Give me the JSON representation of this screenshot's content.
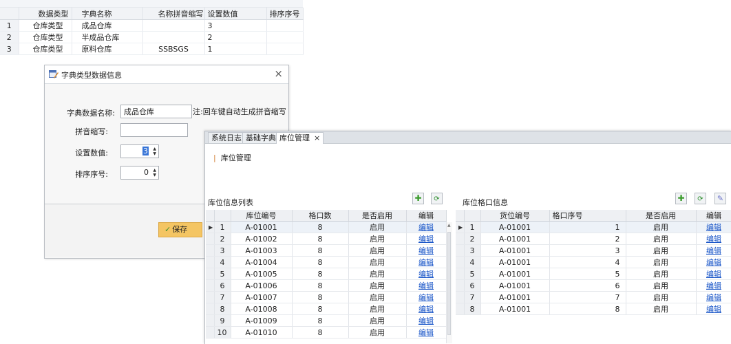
{
  "bg_table": {
    "columns": [
      "数据类型",
      "字典名称",
      "名称拼音缩写",
      "设置数值",
      "排序序号"
    ],
    "rows": [
      {
        "no": "1",
        "type": "仓库类型",
        "name": "成品仓库",
        "abbr": "",
        "value": "3",
        "order": ""
      },
      {
        "no": "2",
        "type": "仓库类型",
        "name": "半成品仓库",
        "abbr": "",
        "value": "2",
        "order": ""
      },
      {
        "no": "3",
        "type": "仓库类型",
        "name": "原料仓库",
        "abbr": "SSBSGS",
        "value": "1",
        "order": ""
      }
    ]
  },
  "dict_dialog": {
    "title": "字典类型数据信息",
    "close": "×",
    "labels": {
      "name": "字典数据名称:",
      "pinyin": "拼音缩写:",
      "value": "设置数值:",
      "order": "排序序号:"
    },
    "fields": {
      "name": "成品仓库",
      "pinyin": "",
      "value": "3",
      "order": "0"
    },
    "note": "注:回车键自动生成拼音缩写",
    "save_label": "保存"
  },
  "location_window": {
    "tabs": [
      "系统日志",
      "基础字典",
      "库位管理"
    ],
    "active_tab": "库位管理",
    "tab_close": "×",
    "breadcrumb": "库位管理",
    "left_grid": {
      "title": "库位信息列表",
      "columns": [
        "库位编号",
        "格口数",
        "是否启用",
        "编辑"
      ],
      "rows": [
        {
          "no": "1",
          "code": "A-01001",
          "slots": "8",
          "enabled": "启用",
          "edit": "编辑"
        },
        {
          "no": "2",
          "code": "A-01002",
          "slots": "8",
          "enabled": "启用",
          "edit": "编辑"
        },
        {
          "no": "3",
          "code": "A-01003",
          "slots": "8",
          "enabled": "启用",
          "edit": "编辑"
        },
        {
          "no": "4",
          "code": "A-01004",
          "slots": "8",
          "enabled": "启用",
          "edit": "编辑"
        },
        {
          "no": "5",
          "code": "A-01005",
          "slots": "8",
          "enabled": "启用",
          "edit": "编辑"
        },
        {
          "no": "6",
          "code": "A-01006",
          "slots": "8",
          "enabled": "启用",
          "edit": "编辑"
        },
        {
          "no": "7",
          "code": "A-01007",
          "slots": "8",
          "enabled": "启用",
          "edit": "编辑"
        },
        {
          "no": "8",
          "code": "A-01008",
          "slots": "8",
          "enabled": "启用",
          "edit": "编辑"
        },
        {
          "no": "9",
          "code": "A-01009",
          "slots": "8",
          "enabled": "启用",
          "edit": "编辑"
        },
        {
          "no": "10",
          "code": "A-01010",
          "slots": "8",
          "enabled": "启用",
          "edit": "编辑"
        }
      ]
    },
    "right_grid": {
      "title": "库位格口信息",
      "columns": [
        "货位编号",
        "格口序号",
        "是否启用",
        "编辑"
      ],
      "rows": [
        {
          "no": "1",
          "code": "A-01001",
          "seq": "1",
          "enabled": "启用",
          "edit": "编辑"
        },
        {
          "no": "2",
          "code": "A-01001",
          "seq": "2",
          "enabled": "启用",
          "edit": "编辑"
        },
        {
          "no": "3",
          "code": "A-01001",
          "seq": "3",
          "enabled": "启用",
          "edit": "编辑"
        },
        {
          "no": "4",
          "code": "A-01001",
          "seq": "4",
          "enabled": "启用",
          "edit": "编辑"
        },
        {
          "no": "5",
          "code": "A-01001",
          "seq": "5",
          "enabled": "启用",
          "edit": "编辑"
        },
        {
          "no": "6",
          "code": "A-01001",
          "seq": "6",
          "enabled": "启用",
          "edit": "编辑"
        },
        {
          "no": "7",
          "code": "A-01001",
          "seq": "7",
          "enabled": "启用",
          "edit": "编辑"
        },
        {
          "no": "8",
          "code": "A-01001",
          "seq": "8",
          "enabled": "启用",
          "edit": "编辑"
        }
      ]
    }
  }
}
